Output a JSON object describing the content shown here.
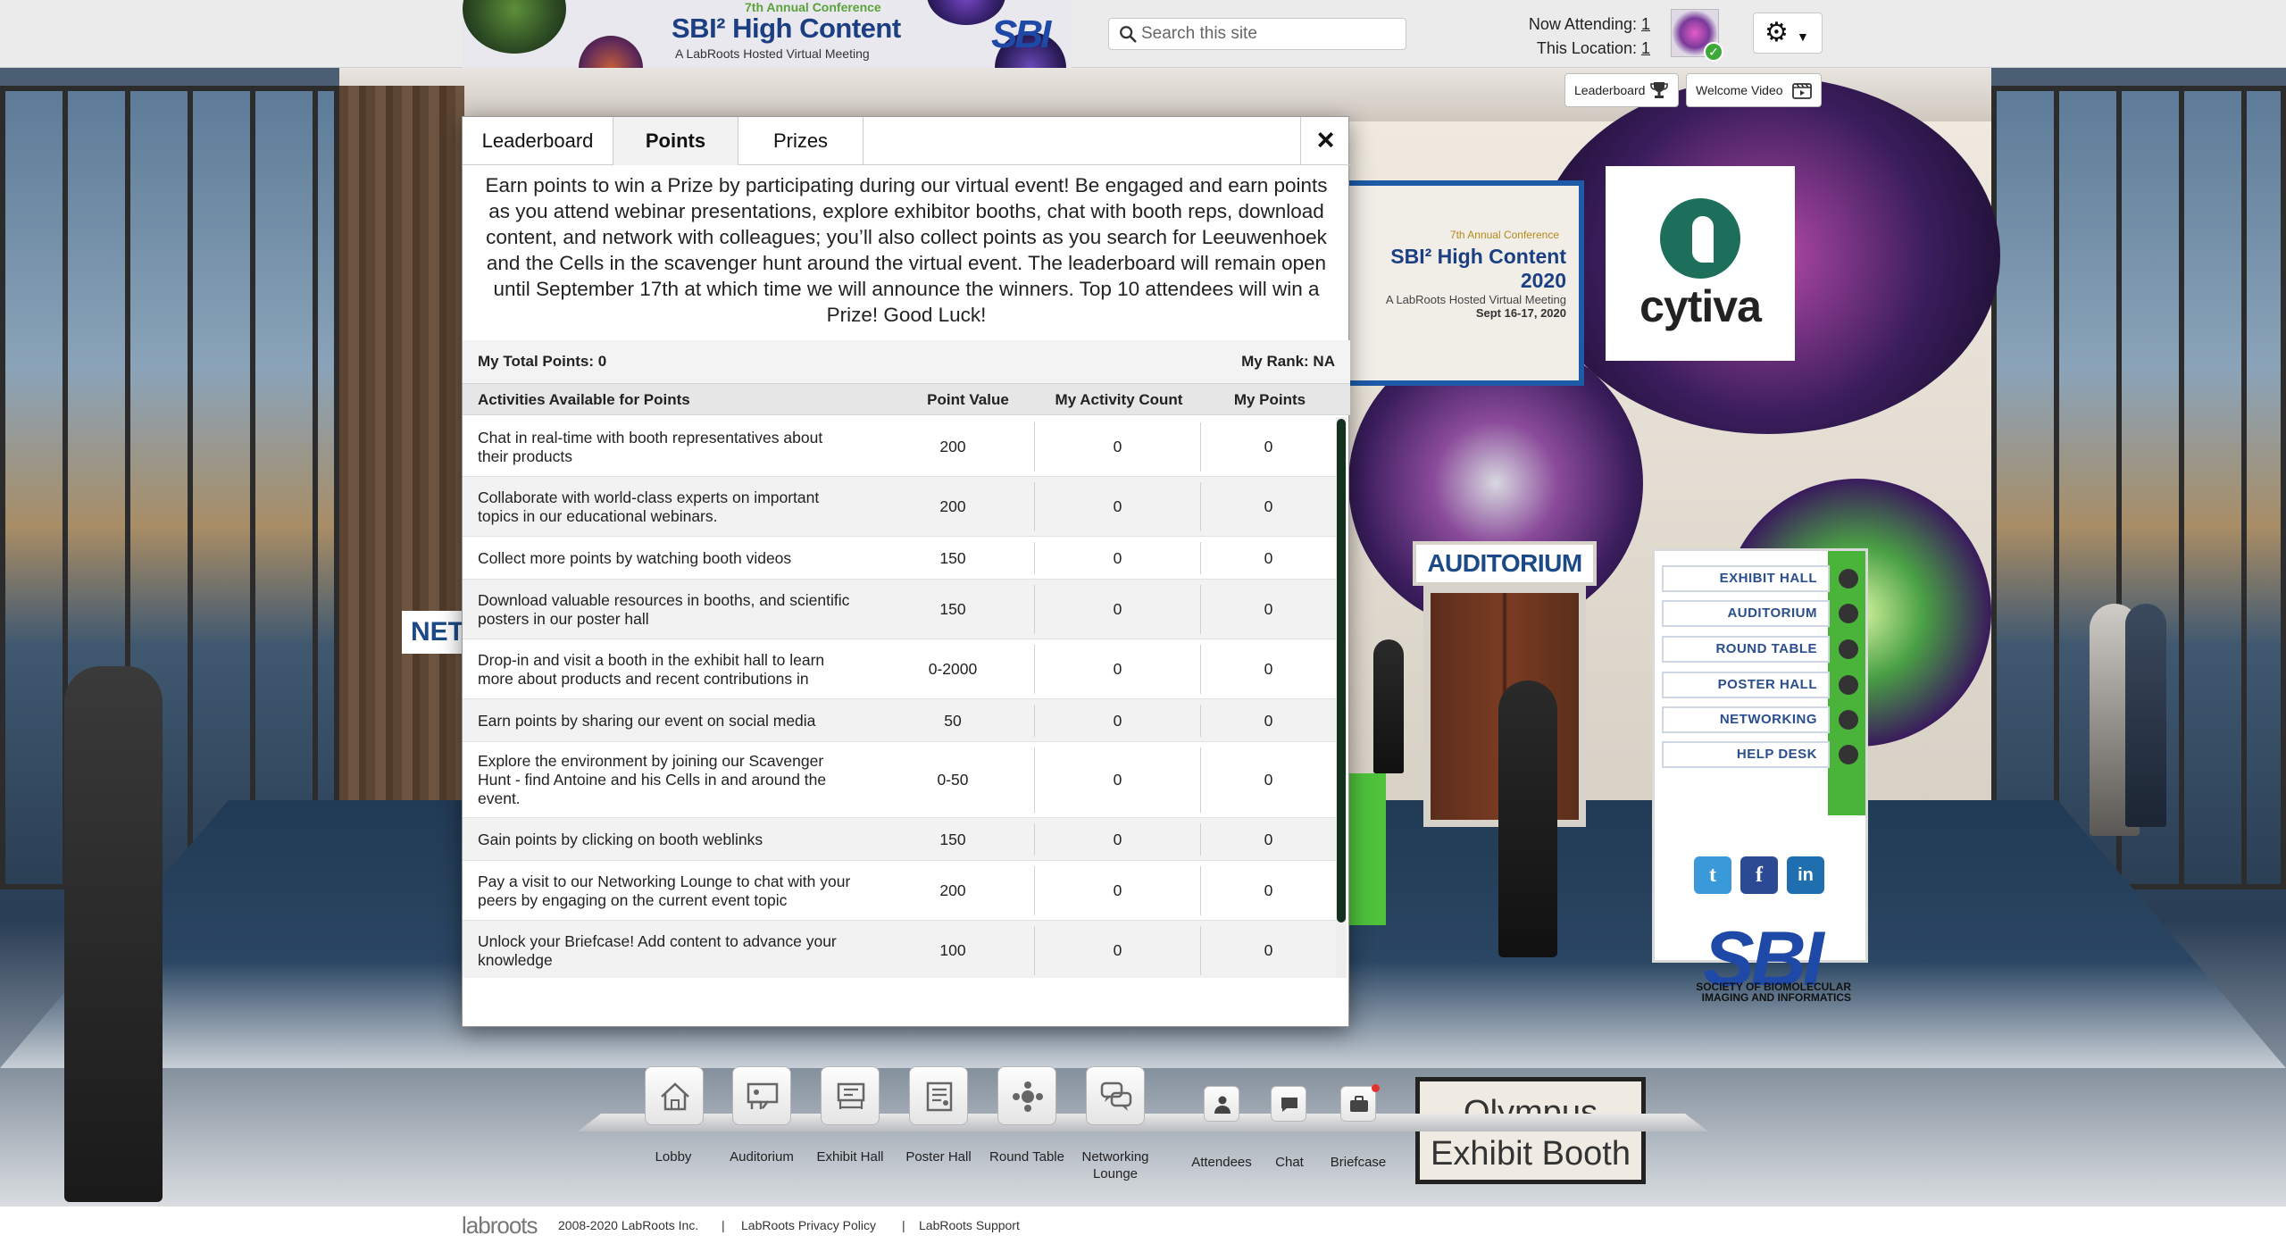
{
  "banner": {
    "annual": "7th Annual Conference",
    "title": "SBI² High Content",
    "subtitle": "A LabRoots Hosted Virtual Meeting",
    "logo_text": "SBI"
  },
  "search": {
    "placeholder": "Search this site"
  },
  "attendance": {
    "now_label": "Now Attending:",
    "now_value": "1",
    "location_label": "This Location:",
    "location_value": "1"
  },
  "quick_buttons": {
    "leaderboard": "Leaderboard",
    "welcome_video": "Welcome Video"
  },
  "modal": {
    "tabs": [
      {
        "label": "Leaderboard",
        "active": false
      },
      {
        "label": "Points",
        "active": true
      },
      {
        "label": "Prizes",
        "active": false
      }
    ],
    "close": "×",
    "intro": "Earn points to win a Prize by participating during our virtual event! Be engaged and earn points as you attend webinar presentations, explore exhibitor booths, chat with booth reps, download content, and network with colleagues; you’ll also collect points as you search for Leeuwenhoek and the Cells in the scavenger hunt around the virtual event. The leaderboard will remain open until September 17th at which time we will announce the winners. Top 10 attendees will win a Prize! Good Luck!",
    "total_points": "My Total Points: 0",
    "rank": "My Rank: NA",
    "columns": [
      "Activities Available for Points",
      "Point Value",
      "My Activity Count",
      "My Points"
    ],
    "rows": [
      {
        "activity": "Chat in real-time with booth representatives about their products",
        "value": "200",
        "count": "0",
        "points": "0"
      },
      {
        "activity": "Collaborate with world-class experts on important topics in our educational webinars.",
        "value": "200",
        "count": "0",
        "points": "0"
      },
      {
        "activity": "Collect more points by watching booth videos",
        "value": "150",
        "count": "0",
        "points": "0"
      },
      {
        "activity": "Download valuable resources in booths, and scientific posters in our poster hall",
        "value": "150",
        "count": "0",
        "points": "0"
      },
      {
        "activity": "Drop-in and visit a booth in the exhibit hall to learn more about products and recent contributions in",
        "value": "0-2000",
        "count": "0",
        "points": "0"
      },
      {
        "activity": "Earn points by sharing our event on social media",
        "value": "50",
        "count": "0",
        "points": "0"
      },
      {
        "activity": "Explore the environment by joining our Scavenger Hunt - find Antoine and his Cells in and around the event.",
        "value": "0-50",
        "count": "0",
        "points": "0"
      },
      {
        "activity": "Gain points by clicking on booth weblinks",
        "value": "150",
        "count": "0",
        "points": "0"
      },
      {
        "activity": "Pay a visit to our Networking Lounge to chat with your peers by engaging on the current event topic",
        "value": "200",
        "count": "0",
        "points": "0"
      },
      {
        "activity": "Unlock your Briefcase! Add content to advance your knowledge",
        "value": "100",
        "count": "0",
        "points": "0"
      }
    ]
  },
  "scene": {
    "conf_sign": {
      "annual": "7th Annual Conference",
      "title": "SBI² High Content 2020",
      "subtitle": "A LabRoots Hosted Virtual Meeting",
      "dates": "Sept 16-17, 2020"
    },
    "cytiva": "cytiva",
    "auditorium": "AUDITORIUM",
    "net_sign": "NET",
    "nav_board": [
      "EXHIBIT HALL",
      "AUDITORIUM",
      "ROUND TABLE",
      "POSTER HALL",
      "NETWORKING",
      "HELP DESK"
    ],
    "social": [
      "t",
      "f",
      "in"
    ],
    "sbi_big": "SBI",
    "sbi_sub": "SOCIETY OF BIOMOLECULAR IMAGING AND INFORMATICS",
    "olympus": "Olympus Exhibit Booth"
  },
  "dock": {
    "main": [
      "Lobby",
      "Auditorium",
      "Exhibit Hall",
      "Poster Hall",
      "Round Table",
      "Networking Lounge"
    ],
    "side": [
      "Attendees",
      "Chat",
      "Briefcase"
    ]
  },
  "footer": {
    "logo": "labroots",
    "copyright": "2008-2020 LabRoots Inc.",
    "sep": "|",
    "privacy": "LabRoots Privacy Policy",
    "support": "LabRoots Support"
  }
}
